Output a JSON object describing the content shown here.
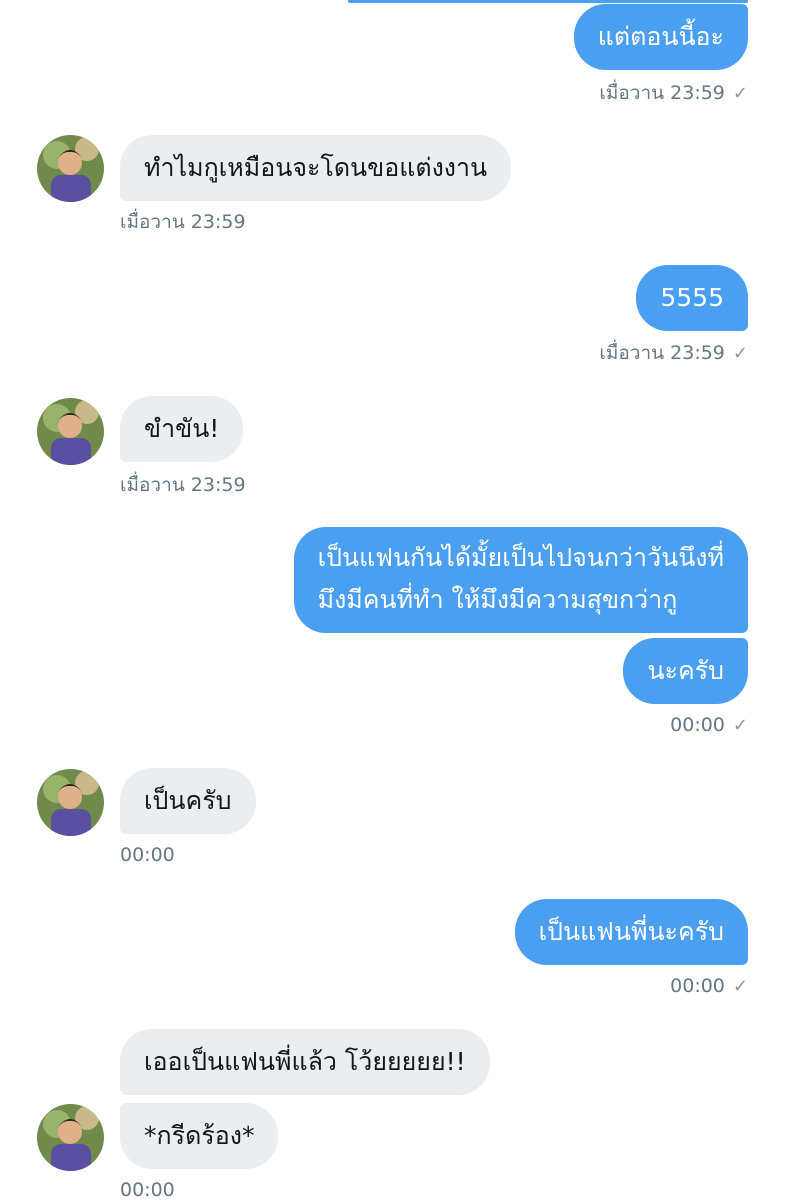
{
  "conversation": {
    "msg1": {
      "text": "แต่ตอนนี้อะ",
      "time": "เมื่อวาน 23:59"
    },
    "msg2": {
      "text": "ทำไมกูเหมือนจะโดนขอแต่งงาน",
      "time": "เมื่อวาน 23:59"
    },
    "msg3": {
      "text": "5555",
      "time": "เมื่อวาน 23:59"
    },
    "msg4": {
      "text": "ขำขัน!",
      "time": "เมื่อวาน 23:59"
    },
    "msg5": {
      "line1": "เป็นแฟนกันได้มั้ยเป็นไปจนกว่าวันนึงที่",
      "line2": "มึงมีคนที่ทำ ให้มึงมีความสุขกว่ากู"
    },
    "msg6": {
      "text": "นะครับ",
      "time": "00:00"
    },
    "msg7": {
      "text": "เป็นครับ",
      "time": "00:00"
    },
    "msg8": {
      "text": "เป็นแฟนพี่นะครับ",
      "time": "00:00"
    },
    "msg9": {
      "text": "เออเป็นแฟนพี่แล้ว โว้ยยยยย!!"
    },
    "msg10": {
      "text": "*กรีดร้อง*",
      "time": "00:00"
    },
    "sent_check": "✓"
  },
  "colors": {
    "outgoing_bubble": "#4a9ff1",
    "incoming_bubble": "#ebeef0",
    "timestamp": "#657786"
  }
}
